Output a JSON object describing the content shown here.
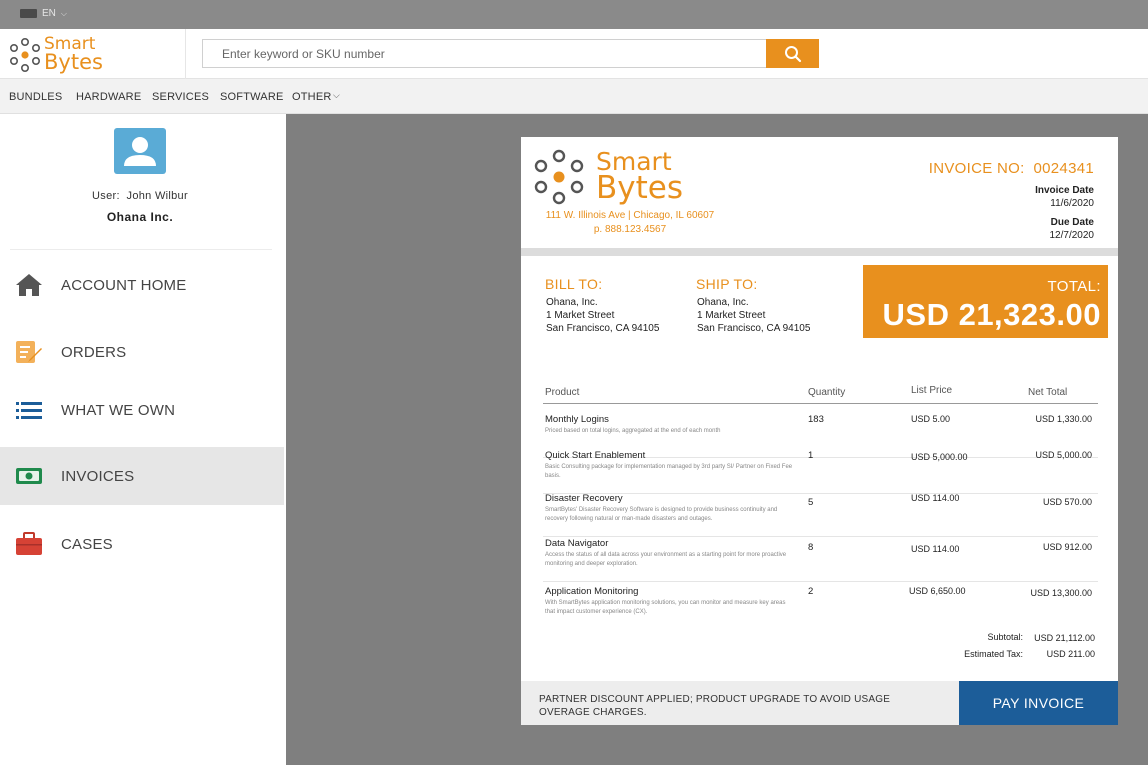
{
  "topbar": {
    "language": "EN"
  },
  "brand": {
    "line1": "Smart",
    "line2": "Bytes"
  },
  "search": {
    "placeholder": "Enter keyword or SKU number"
  },
  "nav": {
    "items": [
      {
        "label": "BUNDLES"
      },
      {
        "label": "HARDWARE"
      },
      {
        "label": "SERVICES"
      },
      {
        "label": "SOFTWARE"
      },
      {
        "label": "OTHER"
      }
    ]
  },
  "user": {
    "label": "User:",
    "name": "John Wilbur",
    "org": "Ohana Inc."
  },
  "sidebar": {
    "items": [
      {
        "label": "ACCOUNT HOME",
        "icon": "home-icon"
      },
      {
        "label": "ORDERS",
        "icon": "orders-icon"
      },
      {
        "label": "WHAT WE OWN",
        "icon": "list-icon"
      },
      {
        "label": "INVOICES",
        "icon": "money-icon",
        "active": true
      },
      {
        "label": "CASES",
        "icon": "briefcase-icon"
      }
    ]
  },
  "invoice": {
    "brand_line1": "Smart",
    "brand_line2": "Bytes",
    "address_line1": "111 W. Illinois Ave | Chicago, IL 60607",
    "address_line2": "p. 888.123.4567",
    "number_label": "INVOICE NO:",
    "number": "0024341",
    "invoice_date_label": "Invoice Date",
    "invoice_date": "11/6/2020",
    "due_date_label": "Due Date",
    "due_date": "12/7/2020",
    "bill_to": {
      "heading": "BILL TO:",
      "line1": "Ohana, Inc.",
      "line2": "1 Market Street",
      "line3": "San Francisco, CA 94105"
    },
    "ship_to": {
      "heading": "SHIP TO:",
      "line1": "Ohana, Inc.",
      "line2": "1 Market Street",
      "line3": "San Francisco, CA 94105"
    },
    "total_label": "TOTAL:",
    "total_amount": "USD 21,323.00",
    "columns": {
      "product": "Product",
      "quantity": "Quantity",
      "list_price": "List Price",
      "net_total": "Net Total"
    },
    "rows": [
      {
        "name": "Monthly Logins",
        "desc": "Priced based on total logins, aggregated at the end of each month",
        "qty": "183",
        "list_price": "USD 5.00",
        "net_total": "USD 1,330.00"
      },
      {
        "name": "Quick Start Enablement",
        "desc": "Basic Consulting package for implementation managed by 3rd party SI/ Partner on Fixed Fee basis.",
        "qty": "1",
        "list_price": "USD 5,000.00",
        "net_total": "USD 5,000.00"
      },
      {
        "name": "Disaster Recovery",
        "desc": "SmartBytes' Disaster Recovery Software is designed to provide business continuity and recovery following natural or man-made disasters and outages.",
        "qty": "5",
        "list_price": "USD 114.00",
        "net_total": "USD 570.00"
      },
      {
        "name": "Data Navigator",
        "desc": "Access the status of all data across your environment as a starting point for more proactive monitoring and deeper exploration.",
        "qty": "8",
        "list_price": "USD 114.00",
        "net_total": "USD 912.00"
      },
      {
        "name": "Application Monitoring",
        "desc": "With SmartBytes application monitoring solutions, you can monitor and measure key areas that impact customer experience (CX).",
        "qty": "2",
        "list_price": "USD 6,650.00",
        "net_total": "USD 13,300.00"
      }
    ],
    "subtotal_label": "Subtotal:",
    "subtotal": "USD 21,112.00",
    "tax_label": "Estimated Tax:",
    "tax": "USD 211.00",
    "footer_note": "PARTNER DISCOUNT APPLIED; PRODUCT UPGRADE TO AVOID USAGE OVERAGE CHARGES.",
    "pay_button": "PAY INVOICE"
  },
  "colors": {
    "accent": "#e8901e",
    "primary": "#1c5d99",
    "avatar": "#5aabd6"
  }
}
